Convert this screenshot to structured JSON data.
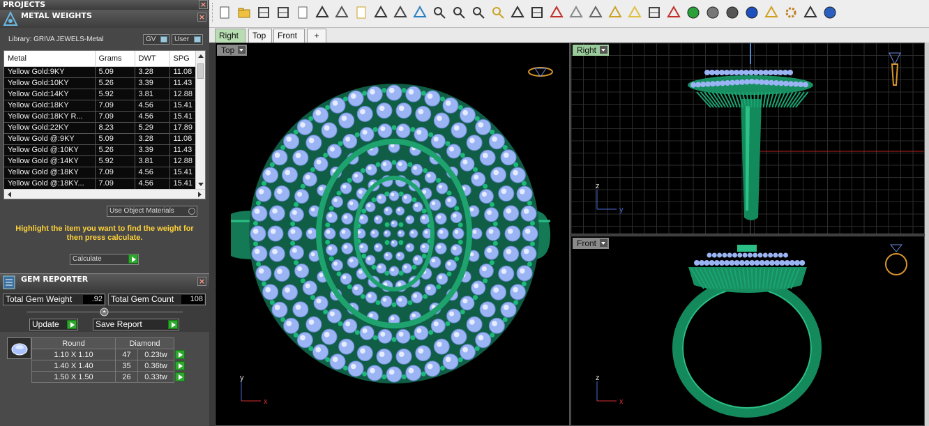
{
  "left_panel": {
    "projects_title": "PROJECTS",
    "metal_weights": {
      "title": "METAL WEIGHTS",
      "library": "Library: GRIVA JEWELS-Metal",
      "gv_label": "GV",
      "user_label": "User",
      "columns": [
        "Metal",
        "Grams",
        "DWT",
        "SPG"
      ],
      "rows": [
        [
          "Yellow Gold:9KY",
          "5.09",
          "3.28",
          "11.08"
        ],
        [
          "Yellow Gold:10KY",
          "5.26",
          "3.39",
          "11.43"
        ],
        [
          "Yellow Gold:14KY",
          "5.92",
          "3.81",
          "12.88"
        ],
        [
          "Yellow Gold:18KY",
          "7.09",
          "4.56",
          "15.41"
        ],
        [
          "Yellow Gold:18KY R...",
          "7.09",
          "4.56",
          "15.41"
        ],
        [
          "Yellow Gold:22KY",
          "8.23",
          "5.29",
          "17.89"
        ],
        [
          "Yellow Gold @:9KY",
          "5.09",
          "3.28",
          "11.08"
        ],
        [
          "Yellow Gold @:10KY",
          "5.26",
          "3.39",
          "11.43"
        ],
        [
          "Yellow Gold @:14KY",
          "5.92",
          "3.81",
          "12.88"
        ],
        [
          "Yellow Gold @:18KY",
          "7.09",
          "4.56",
          "15.41"
        ],
        [
          "Yellow Gold @:18KY...",
          "7.09",
          "4.56",
          "15.41"
        ]
      ],
      "use_object_materials": "Use Object Materials",
      "instruction": "Highlight the item you want to find the weight for then press calculate.",
      "calculate_label": "Calculate"
    },
    "gem_reporter": {
      "title": "GEM REPORTER",
      "total_gem_weight_label": "Total Gem Weight",
      "total_gem_weight": ".92",
      "total_gem_count_label": "Total Gem Count",
      "total_gem_count": "108",
      "update_label": "Update",
      "save_report_label": "Save Report",
      "headers": [
        "Round",
        "Diamond"
      ],
      "rows": [
        {
          "size": "1.10 X 1.10",
          "count": "47",
          "weight": "0.23tw"
        },
        {
          "size": "1.40 X 1.40",
          "count": "35",
          "weight": "0.36tw"
        },
        {
          "size": "1.50 X 1.50",
          "count": "26",
          "weight": "0.33tw"
        }
      ]
    }
  },
  "toolbar": {
    "icons": [
      "new-file-icon",
      "open-folder-icon",
      "save-icon",
      "print-icon",
      "import-icon",
      "cut-icon",
      "copy-icon",
      "paste-icon",
      "undo-icon",
      "pan-hand-icon",
      "move-icon",
      "zoom-icon",
      "zoom-window-icon",
      "zoom-extents-icon",
      "zoom-selected-icon",
      "rotate-view-icon",
      "four-viewports-icon",
      "car-icon",
      "plane-icon",
      "grid-snap-icon",
      "select-icon",
      "light-bulb-icon",
      "lock-icon",
      "layers-icon",
      "color-wheel-icon",
      "shade-icon",
      "render-sphere-icon",
      "blue-sphere-icon",
      "pencil-icon",
      "gear-icon",
      "dimension-icon",
      "help-icon"
    ]
  },
  "tabs": [
    {
      "label": "Right",
      "active": true
    },
    {
      "label": "Top",
      "active": false
    },
    {
      "label": "Front",
      "active": false
    },
    {
      "label": "+",
      "active": false
    }
  ],
  "viewports": {
    "top": {
      "label": "Top",
      "axis_x": "x",
      "axis_y": "y"
    },
    "right": {
      "label": "Right",
      "axis_h": "y",
      "axis_v": "z"
    },
    "front": {
      "label": "Front",
      "axis_h": "x",
      "axis_v": "z"
    }
  },
  "colors": {
    "metal_green": "#1f9a6a",
    "gem_blue": "#9ab4f4",
    "highlight_yellow": "#ffd23a",
    "active_tab": "#b8ddb2"
  }
}
